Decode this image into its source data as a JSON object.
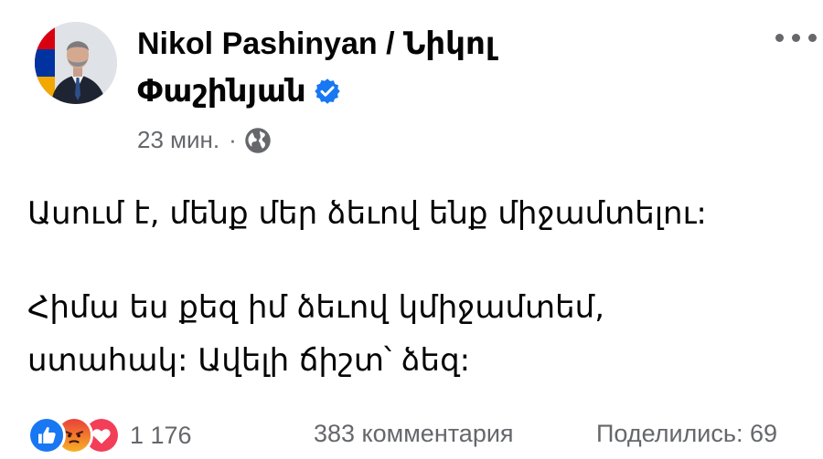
{
  "post": {
    "author_line1": "Nikol Pashinyan / Նիկոլ",
    "author_line2": "Փաշինյան",
    "timestamp": "23 мин.",
    "separator": "·",
    "verified_icon": "verified-badge-icon",
    "audience_icon": "globe-icon",
    "paragraph1": "Ասում է, մենք մեր ձեւով ենք միջամտելու:",
    "paragraph2_line1": "Հիմա ես քեզ իմ ձեւով կմիջամտեմ,",
    "paragraph2_line2": "ստահակ: Ավելի ճիշտ՝ ձեզ:"
  },
  "footer": {
    "reaction_icons": [
      "like-icon",
      "angry-icon",
      "love-icon"
    ],
    "reactions_count": "1 176",
    "comments": "383 комментария",
    "shares": "Поделились: 69"
  },
  "colors": {
    "text_primary": "#050505",
    "text_secondary": "#65676b",
    "verified_blue": "#1877f2",
    "like_blue": "#1877f2",
    "angry_orange": "#f0633c",
    "love_red": "#f33e58"
  }
}
